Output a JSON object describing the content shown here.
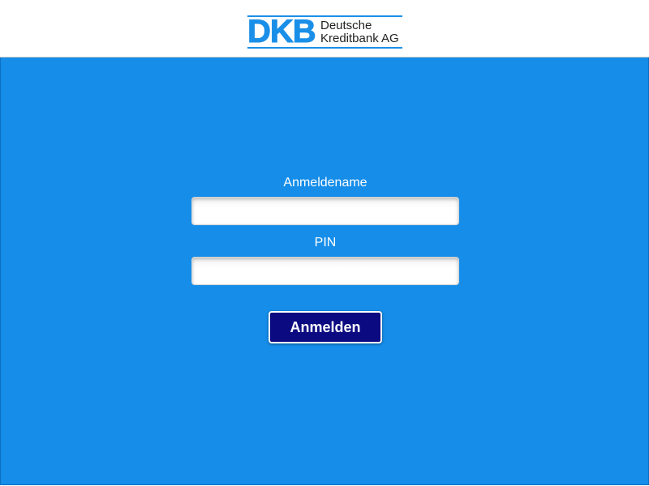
{
  "brand": {
    "mark": "DKB",
    "name_line1": "Deutsche",
    "name_line2": "Kreditbank AG",
    "color": "#1a8fe8"
  },
  "form": {
    "username_label": "Anmeldename",
    "username_value": "",
    "pin_label": "PIN",
    "pin_value": "",
    "submit_label": "Anmelden"
  },
  "colors": {
    "background": "#158de9",
    "button": "#0b0a80"
  }
}
